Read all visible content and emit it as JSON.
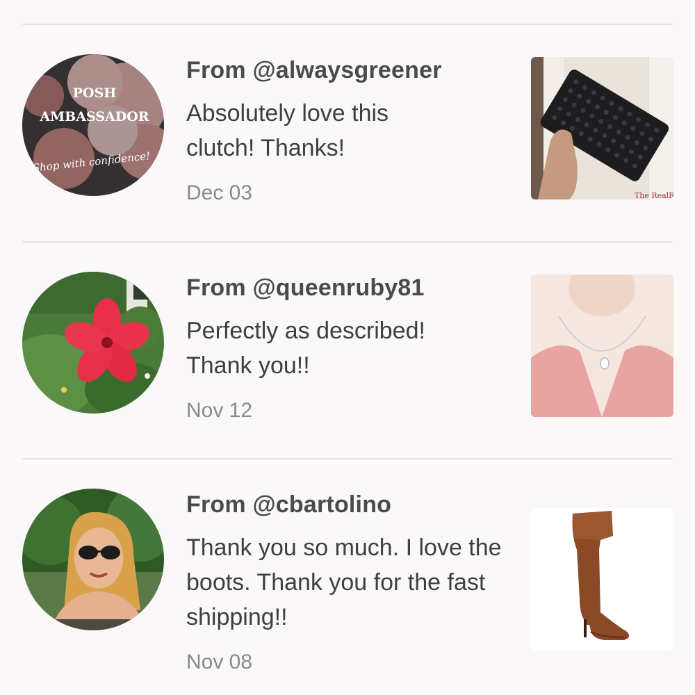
{
  "reviews": [
    {
      "from": "From @alwaysgreener",
      "message": "Absolutely love this clutch! Thanks!",
      "date": "Dec 03",
      "avatar": {
        "icon": "posh-ambassador-badge",
        "title_line1": "POSH",
        "title_line2": "AMBASSADOR",
        "tagline": "Shop with confidence!"
      },
      "item": {
        "icon": "black-studded-clutch",
        "label": "The RealReal"
      }
    },
    {
      "from": "From @queenruby81",
      "message": "Perfectly as described! Thank you!!",
      "date": "Nov 12",
      "avatar": {
        "icon": "red-hibiscus-photo"
      },
      "item": {
        "icon": "silver-pendant-necklace"
      }
    },
    {
      "from": "From @cbartolino",
      "message": "Thank you so much. I love the boots. Thank you for the fast shipping!!",
      "date": "Nov 08",
      "avatar": {
        "icon": "woman-sunglasses-photo"
      },
      "item": {
        "icon": "brown-knee-high-boot"
      }
    }
  ],
  "colors": {
    "background": "#faf8f9",
    "divider": "#e6e4e5",
    "username": "#4a4a4a",
    "message": "#3f3f3f",
    "date": "#8a8a8a"
  }
}
